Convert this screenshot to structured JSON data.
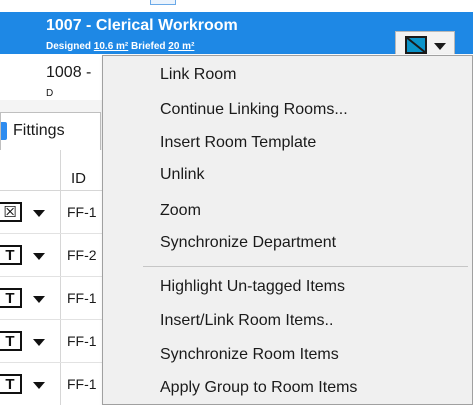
{
  "rooms": {
    "selected": {
      "title": "1007  -  Clerical Workroom",
      "designed_label": "Designed",
      "designed_value": "10.6 m²",
      "briefed_label": "Briefed",
      "briefed_value": "20 m²"
    },
    "next": {
      "title": "1008  -",
      "sub": "D"
    }
  },
  "room_dropdown": {
    "swatch_colors": [
      "#0a93c9",
      "#1a1a1a"
    ]
  },
  "tabs": {
    "fittings_label": "Fittings"
  },
  "grid": {
    "id_header": "ID",
    "rows": [
      {
        "tag": "☒",
        "id": "FF-1"
      },
      {
        "tag": "T",
        "id": "FF-2"
      },
      {
        "tag": "T",
        "id": "FF-1"
      },
      {
        "tag": "T",
        "id": "FF-1"
      },
      {
        "tag": "T",
        "id": "FF-1"
      }
    ]
  },
  "context_menu": {
    "group1": [
      "Link Room",
      "Continue Linking Rooms...",
      "Insert Room Template",
      "Unlink",
      "Zoom",
      "Synchronize Department"
    ],
    "group2": [
      "Highlight Un-tagged Items",
      "Insert/Link Room Items..",
      "Synchronize Room Items",
      "Apply Group to Room Items"
    ]
  },
  "colors": {
    "selection_blue": "#1e88e5",
    "menu_bg": "#f0f0f0"
  }
}
